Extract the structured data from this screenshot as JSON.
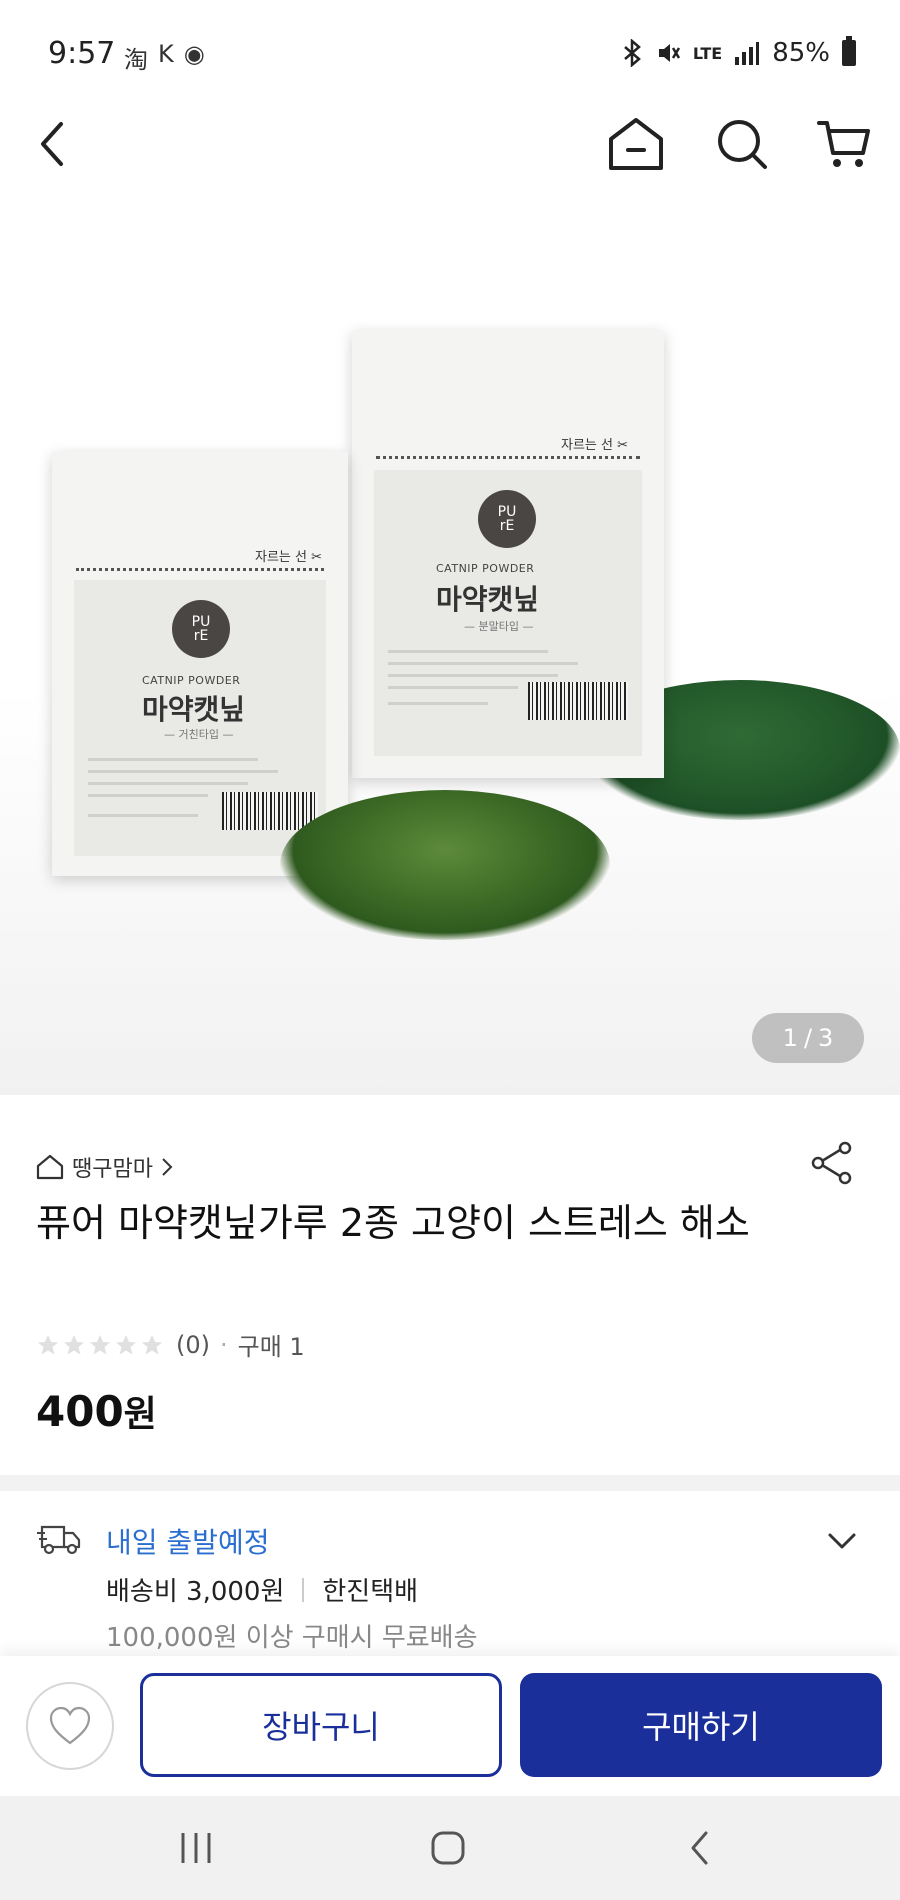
{
  "status_bar": {
    "time": "9:57",
    "app_icons": [
      "淘",
      "K",
      "◉"
    ],
    "network": "LTE",
    "battery": "85%"
  },
  "nav": {
    "icons": [
      "back-icon",
      "home-icon",
      "search-icon",
      "cart-icon"
    ]
  },
  "hero": {
    "page_current": "1",
    "page_sep": "/",
    "page_total": "3",
    "packets": [
      {
        "cut_text": "자르는 선 ✂",
        "logo": "PU\nrE",
        "en": "CATNIP POWDER",
        "ko": "마약캣닢",
        "sub": "— 거친타입 —"
      },
      {
        "cut_text": "자르는 선 ✂",
        "logo": "PU\nrE",
        "en": "CATNIP POWDER",
        "ko": "마약캣닢",
        "sub": "— 분말타입 —"
      }
    ]
  },
  "product": {
    "seller": "땡구맘마",
    "title": "퓨어 마약캣닢가루 2종 고양이 스트레스 해소",
    "rating_count": "(0)",
    "purchase": "구매 1",
    "price": "400",
    "currency": "원",
    "stars_filled": 0,
    "stars_total": 5
  },
  "shipping": {
    "title": "내일 출발예정",
    "fee": "배송비 3,000원",
    "carrier": "한진택배",
    "free_note": "100,000원 이상 구매시 무료배송"
  },
  "actions": {
    "cart_label": "장바구니",
    "buy_label": "구매하기"
  },
  "colors": {
    "accent": "#1a2f9a",
    "shipping_blue": "#2a6fd0"
  }
}
